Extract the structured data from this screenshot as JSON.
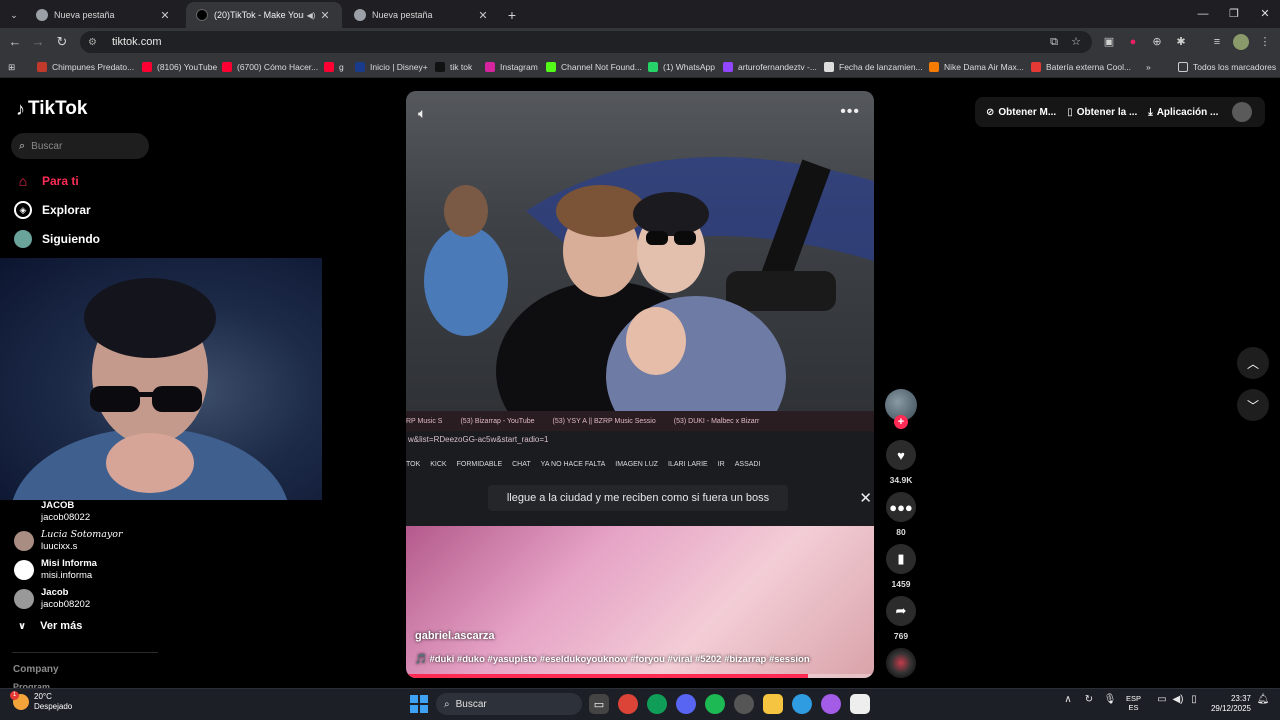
{
  "browser": {
    "tabs": [
      {
        "title": "Nueva pestaña",
        "active": false
      },
      {
        "title": "(20)TikTok - Make Your Day",
        "active": true
      },
      {
        "title": "Nueva pestaña",
        "active": false
      }
    ],
    "url": "tiktok.com",
    "bookmarks": [
      {
        "label": "Chimpunes Predato...",
        "color": "#c0392b"
      },
      {
        "label": "(8106) YouTube",
        "color": "#ff0033"
      },
      {
        "label": "(6700) Cómo Hacer...",
        "color": "#ff0033"
      },
      {
        "label": "g",
        "color": "#ff0033"
      },
      {
        "label": "Inicio | Disney+",
        "color": "#1a3b8c"
      },
      {
        "label": "tik tok",
        "color": "#111111"
      },
      {
        "label": "Instagram",
        "color": "#d6249f"
      },
      {
        "label": "Channel Not Found...",
        "color": "#53fc18"
      },
      {
        "label": "(1) WhatsApp",
        "color": "#25d366"
      },
      {
        "label": "arturofernandeztv -...",
        "color": "#9146ff"
      },
      {
        "label": "Fecha de lanzamien...",
        "color": "#dddddd"
      },
      {
        "label": "Nike Dama Air Max...",
        "color": "#f57c00"
      },
      {
        "label": "Batería externa Cool...",
        "color": "#e53935"
      }
    ],
    "all_bookmarks": "Todos los marcadores"
  },
  "tiktok": {
    "logo": "TikTok",
    "search_placeholder": "Buscar",
    "nav": [
      {
        "label": "Para ti",
        "active": true
      },
      {
        "label": "Explorar",
        "active": false
      },
      {
        "label": "Siguiendo",
        "active": false
      }
    ],
    "following": [
      {
        "name": "JACOB",
        "handle": "jacob08022"
      },
      {
        "name": "Lucia Sotomayor",
        "handle": "luucixx.s"
      },
      {
        "name": "Misi Informa",
        "handle": "misi.informa"
      },
      {
        "name": "Jacob",
        "handle": "jacob08202"
      }
    ],
    "see_more": "Ver más",
    "company": "Company",
    "program": "Program",
    "top_actions": [
      "Obtener M...",
      "Obtener la ...",
      "Aplicación ..."
    ],
    "video": {
      "author": "gabriel.ascarza",
      "description": "🎵 #duki #duko #yasupisto #eseldukoyouknow #foryou #viral #5202 #bizarrap #session",
      "overlay_caption": "llegue a la ciudad y me reciben como si fuera un boss",
      "inner_tabs": [
        "RP Music S",
        "(53) Bizarrap - YouTube",
        "(53) YSY A || BZRP Music Sessio",
        "(53) DUKI - Malbec x Bizarr"
      ],
      "inner_url": "w&list=RDeezoGG-ac5w&start_radio=1",
      "inner_bookmarks": [
        "TOK",
        "KICK",
        "FORMIDABLE",
        "CHAT",
        "YA NO HACE FALTA",
        "IMAGEN LUZ",
        "ILARI LARIE",
        "IR",
        "ASSADI"
      ],
      "progress": 0.86
    },
    "actions": {
      "likes": "34.9K",
      "comments": "80",
      "saves": "1459",
      "shares": "769"
    }
  },
  "taskbar": {
    "weather_temp": "20°C",
    "weather_desc": "Despejado",
    "weather_badge": "1",
    "search": "Buscar",
    "lang_1": "ESP",
    "lang_2": "ES",
    "time": "23:37",
    "date": "29/12/2025"
  }
}
